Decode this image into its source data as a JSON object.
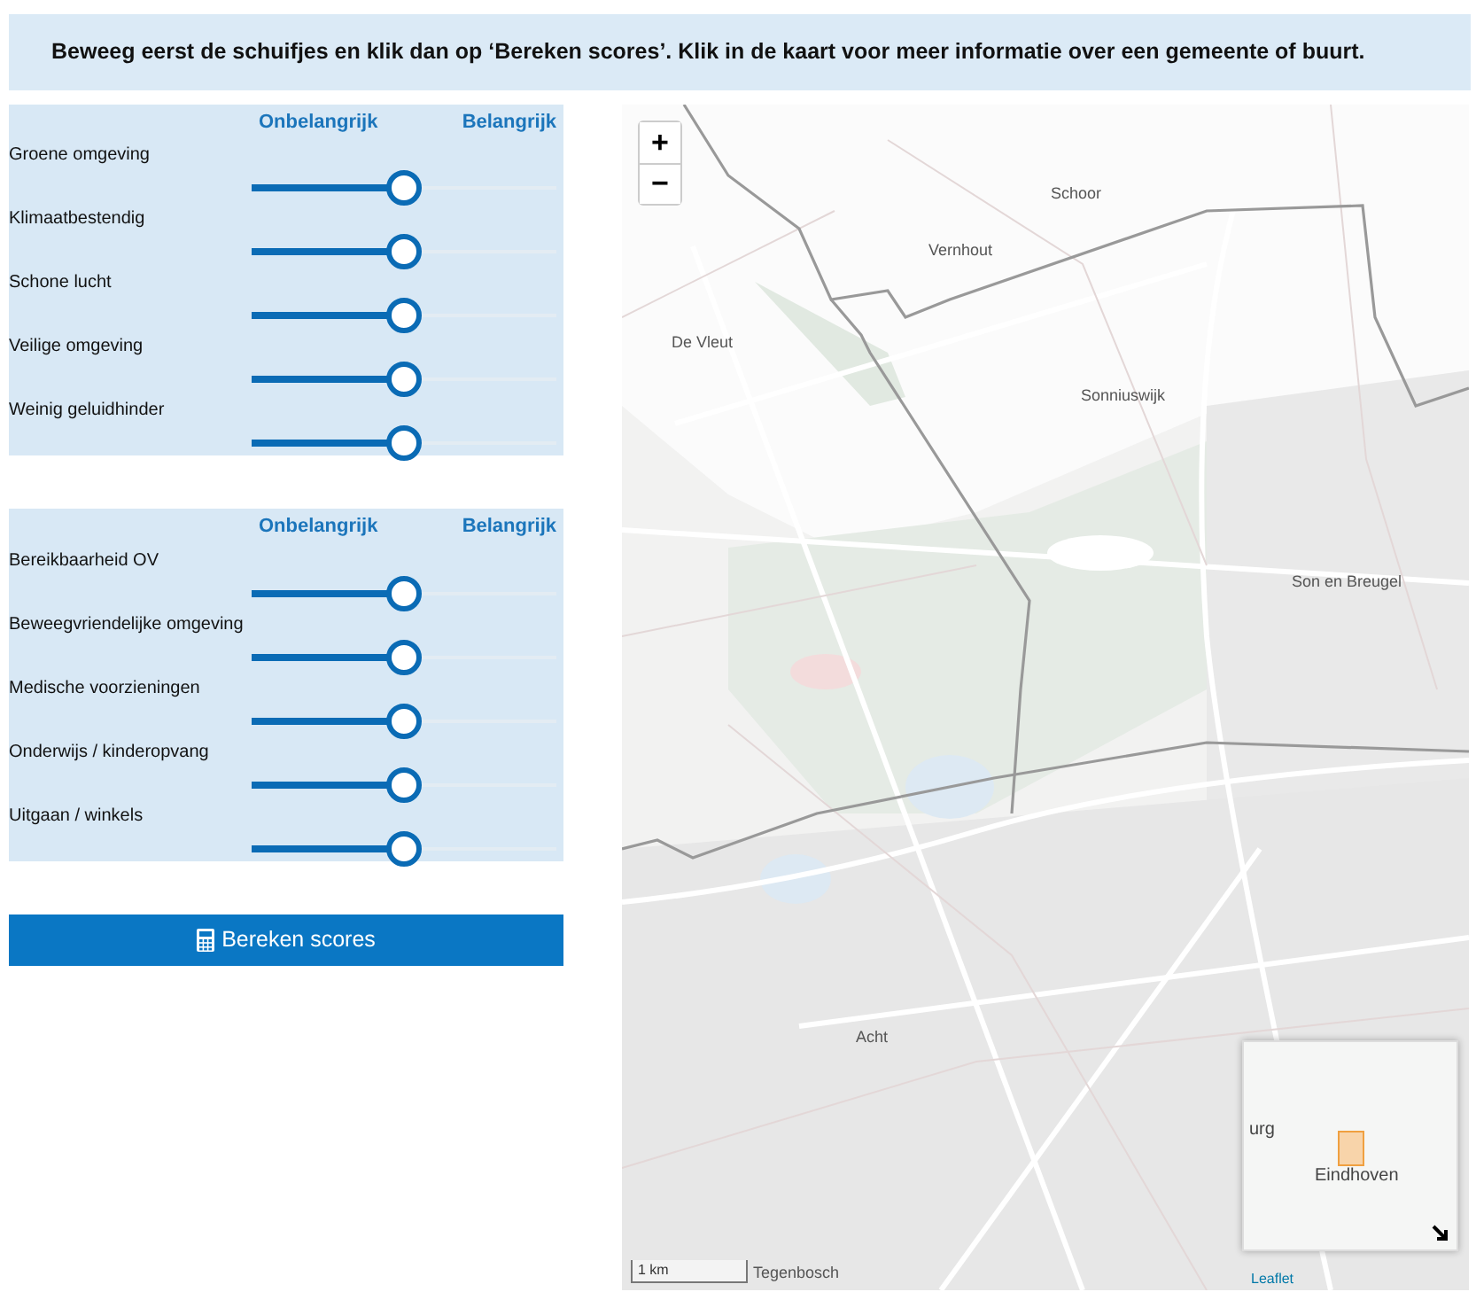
{
  "instruction": "Beweeg eerst de schuifjes en klik dan op ‘Bereken scores’. Klik in de kaart voor meer informatie over een gemeente of buurt.",
  "panels": [
    {
      "scale_low": "Onbelangrijk",
      "scale_high": "Belangrijk",
      "sliders": [
        {
          "label": "Groene omgeving",
          "level": 0.5
        },
        {
          "label": "Klimaatbestendig",
          "level": 0.5
        },
        {
          "label": "Schone lucht",
          "level": 0.5
        },
        {
          "label": "Veilige omgeving",
          "level": 0.5
        },
        {
          "label": "Weinig geluidhinder",
          "level": 0.5
        }
      ]
    },
    {
      "scale_low": "Onbelangrijk",
      "scale_high": "Belangrijk",
      "sliders": [
        {
          "label": "Bereikbaarheid OV",
          "level": 0.5
        },
        {
          "label": "Beweegvriendelijke omgeving",
          "level": 0.5
        },
        {
          "label": "Medische voorzieningen",
          "level": 0.5
        },
        {
          "label": "Onderwijs / kinderopvang",
          "level": 0.5
        },
        {
          "label": "Uitgaan / winkels",
          "level": 0.5
        }
      ]
    }
  ],
  "button": {
    "label": "Bereken scores"
  },
  "map": {
    "zoom_in": "+",
    "zoom_out": "−",
    "place_labels": [
      "Schoor",
      "Vernhout",
      "De Vleut",
      "Sonniuswijk",
      "Son en Breugel",
      "Acht",
      "Tegenbosch"
    ],
    "scale": "1 km",
    "minimap": {
      "labels": [
        "urg",
        "Eindhoven"
      ]
    },
    "attribution": "Leaflet"
  }
}
